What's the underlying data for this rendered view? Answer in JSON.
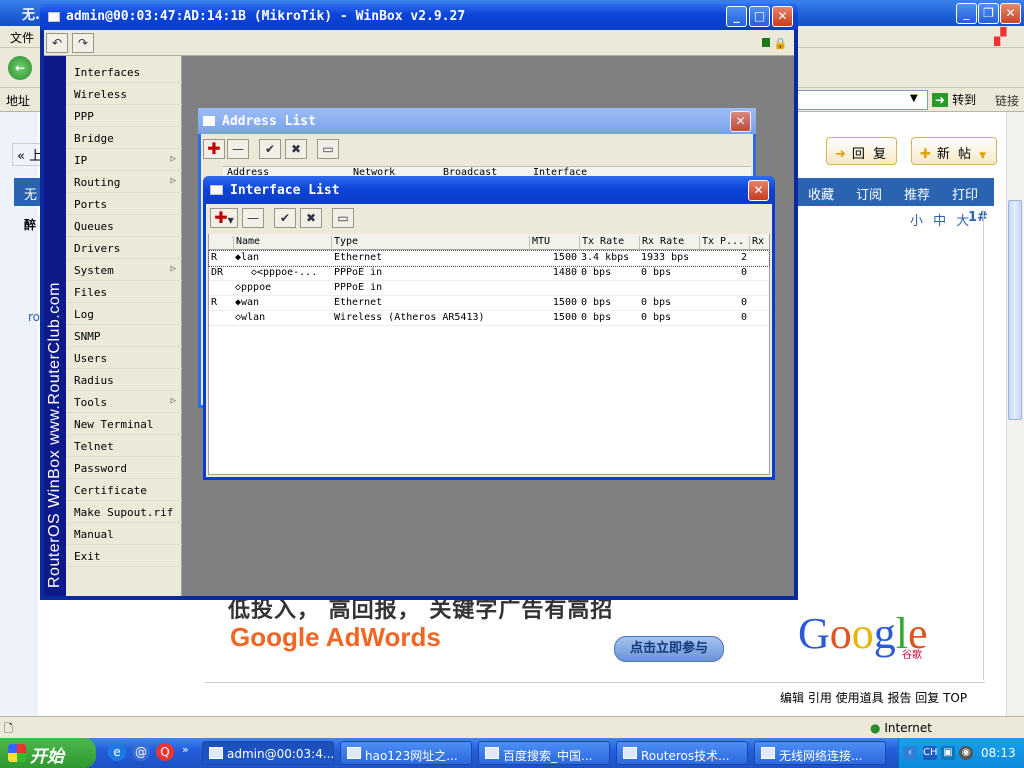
{
  "ie": {
    "title": "无...",
    "menu_first": "文件",
    "address_label": "地址",
    "go_label": "转到",
    "links_label": "链接",
    "prev_link": "« 上",
    "reply_btn": "回 复",
    "new_post_btn": "新 帖",
    "nav_items": [
      "收藏",
      "订阅",
      "推荐",
      "打印"
    ],
    "nav_left": "无",
    "font_size": "小 中 大",
    "floor": "1#",
    "side_frag1": "醉",
    "side_frag2": "ro",
    "ad_line1": "低投入， 高回报， 关键字广告有高招",
    "ad_line2": "Google AdWords",
    "ad_button": "点击立即参与",
    "google_logo": "Google",
    "google_cn": "谷歌",
    "bottom_links": "编辑 引用 使用道具 报告 回复 TOP",
    "status_zone": "Internet"
  },
  "taskbar": {
    "start": "开始",
    "tasks": [
      "admin@00:03:4...",
      "hao123网址之...",
      "百度搜索_中国...",
      "Routeros技术...",
      "无线网络连接..."
    ],
    "tray_lang": "CH",
    "clock": "08:13"
  },
  "winbox": {
    "title": "admin@00:03:47:AD:14:1B (MikroTik) - WinBox v2.9.27",
    "side_text": "RouterOS WinBox   www.RouterClub.com",
    "menu": [
      {
        "label": "Interfaces",
        "sub": false
      },
      {
        "label": "Wireless",
        "sub": false
      },
      {
        "label": "PPP",
        "sub": false
      },
      {
        "label": "Bridge",
        "sub": false
      },
      {
        "label": "IP",
        "sub": true
      },
      {
        "label": "Routing",
        "sub": true
      },
      {
        "label": "Ports",
        "sub": false
      },
      {
        "label": "Queues",
        "sub": false
      },
      {
        "label": "Drivers",
        "sub": false
      },
      {
        "label": "System",
        "sub": true
      },
      {
        "label": "Files",
        "sub": false
      },
      {
        "label": "Log",
        "sub": false
      },
      {
        "label": "SNMP",
        "sub": false
      },
      {
        "label": "Users",
        "sub": false
      },
      {
        "label": "Radius",
        "sub": false
      },
      {
        "label": "Tools",
        "sub": true
      },
      {
        "label": "New Terminal",
        "sub": false
      },
      {
        "label": "Telnet",
        "sub": false
      },
      {
        "label": "Password",
        "sub": false
      },
      {
        "label": "Certificate",
        "sub": false
      },
      {
        "label": "Make Supout.rif",
        "sub": false
      },
      {
        "label": "Manual",
        "sub": false
      },
      {
        "label": "Exit",
        "sub": false
      }
    ]
  },
  "address_list": {
    "title": "Address List",
    "columns": [
      "Address",
      "Network",
      "Broadcast",
      "Interface"
    ]
  },
  "interface_list": {
    "title": "Interface List",
    "columns": [
      "Name",
      "Type",
      "MTU",
      "Tx Rate",
      "Rx Rate",
      "Tx P...",
      "Rx"
    ],
    "rows": [
      {
        "flag": "R",
        "name": "◆lan",
        "type": "Ethernet",
        "mtu": "1500",
        "tx": "3.4 kbps",
        "rx": "1933 bps",
        "txp": "2",
        "sel": true
      },
      {
        "flag": "DR",
        "name": "◇<pppoe-...",
        "type": "PPPoE in",
        "mtu": "1480",
        "tx": "0 bps",
        "rx": "0 bps",
        "txp": "0",
        "sel": false
      },
      {
        "flag": "",
        "name": "◇pppoe",
        "type": "PPPoE in",
        "mtu": "",
        "tx": "",
        "rx": "",
        "txp": "",
        "sel": false
      },
      {
        "flag": "R",
        "name": "◆wan",
        "type": "Ethernet",
        "mtu": "1500",
        "tx": "0 bps",
        "rx": "0 bps",
        "txp": "0",
        "sel": false
      },
      {
        "flag": "",
        "name": "◇wlan",
        "type": "Wireless (Atheros AR5413)",
        "mtu": "1500",
        "tx": "0 bps",
        "rx": "0 bps",
        "txp": "0",
        "sel": false
      }
    ]
  }
}
